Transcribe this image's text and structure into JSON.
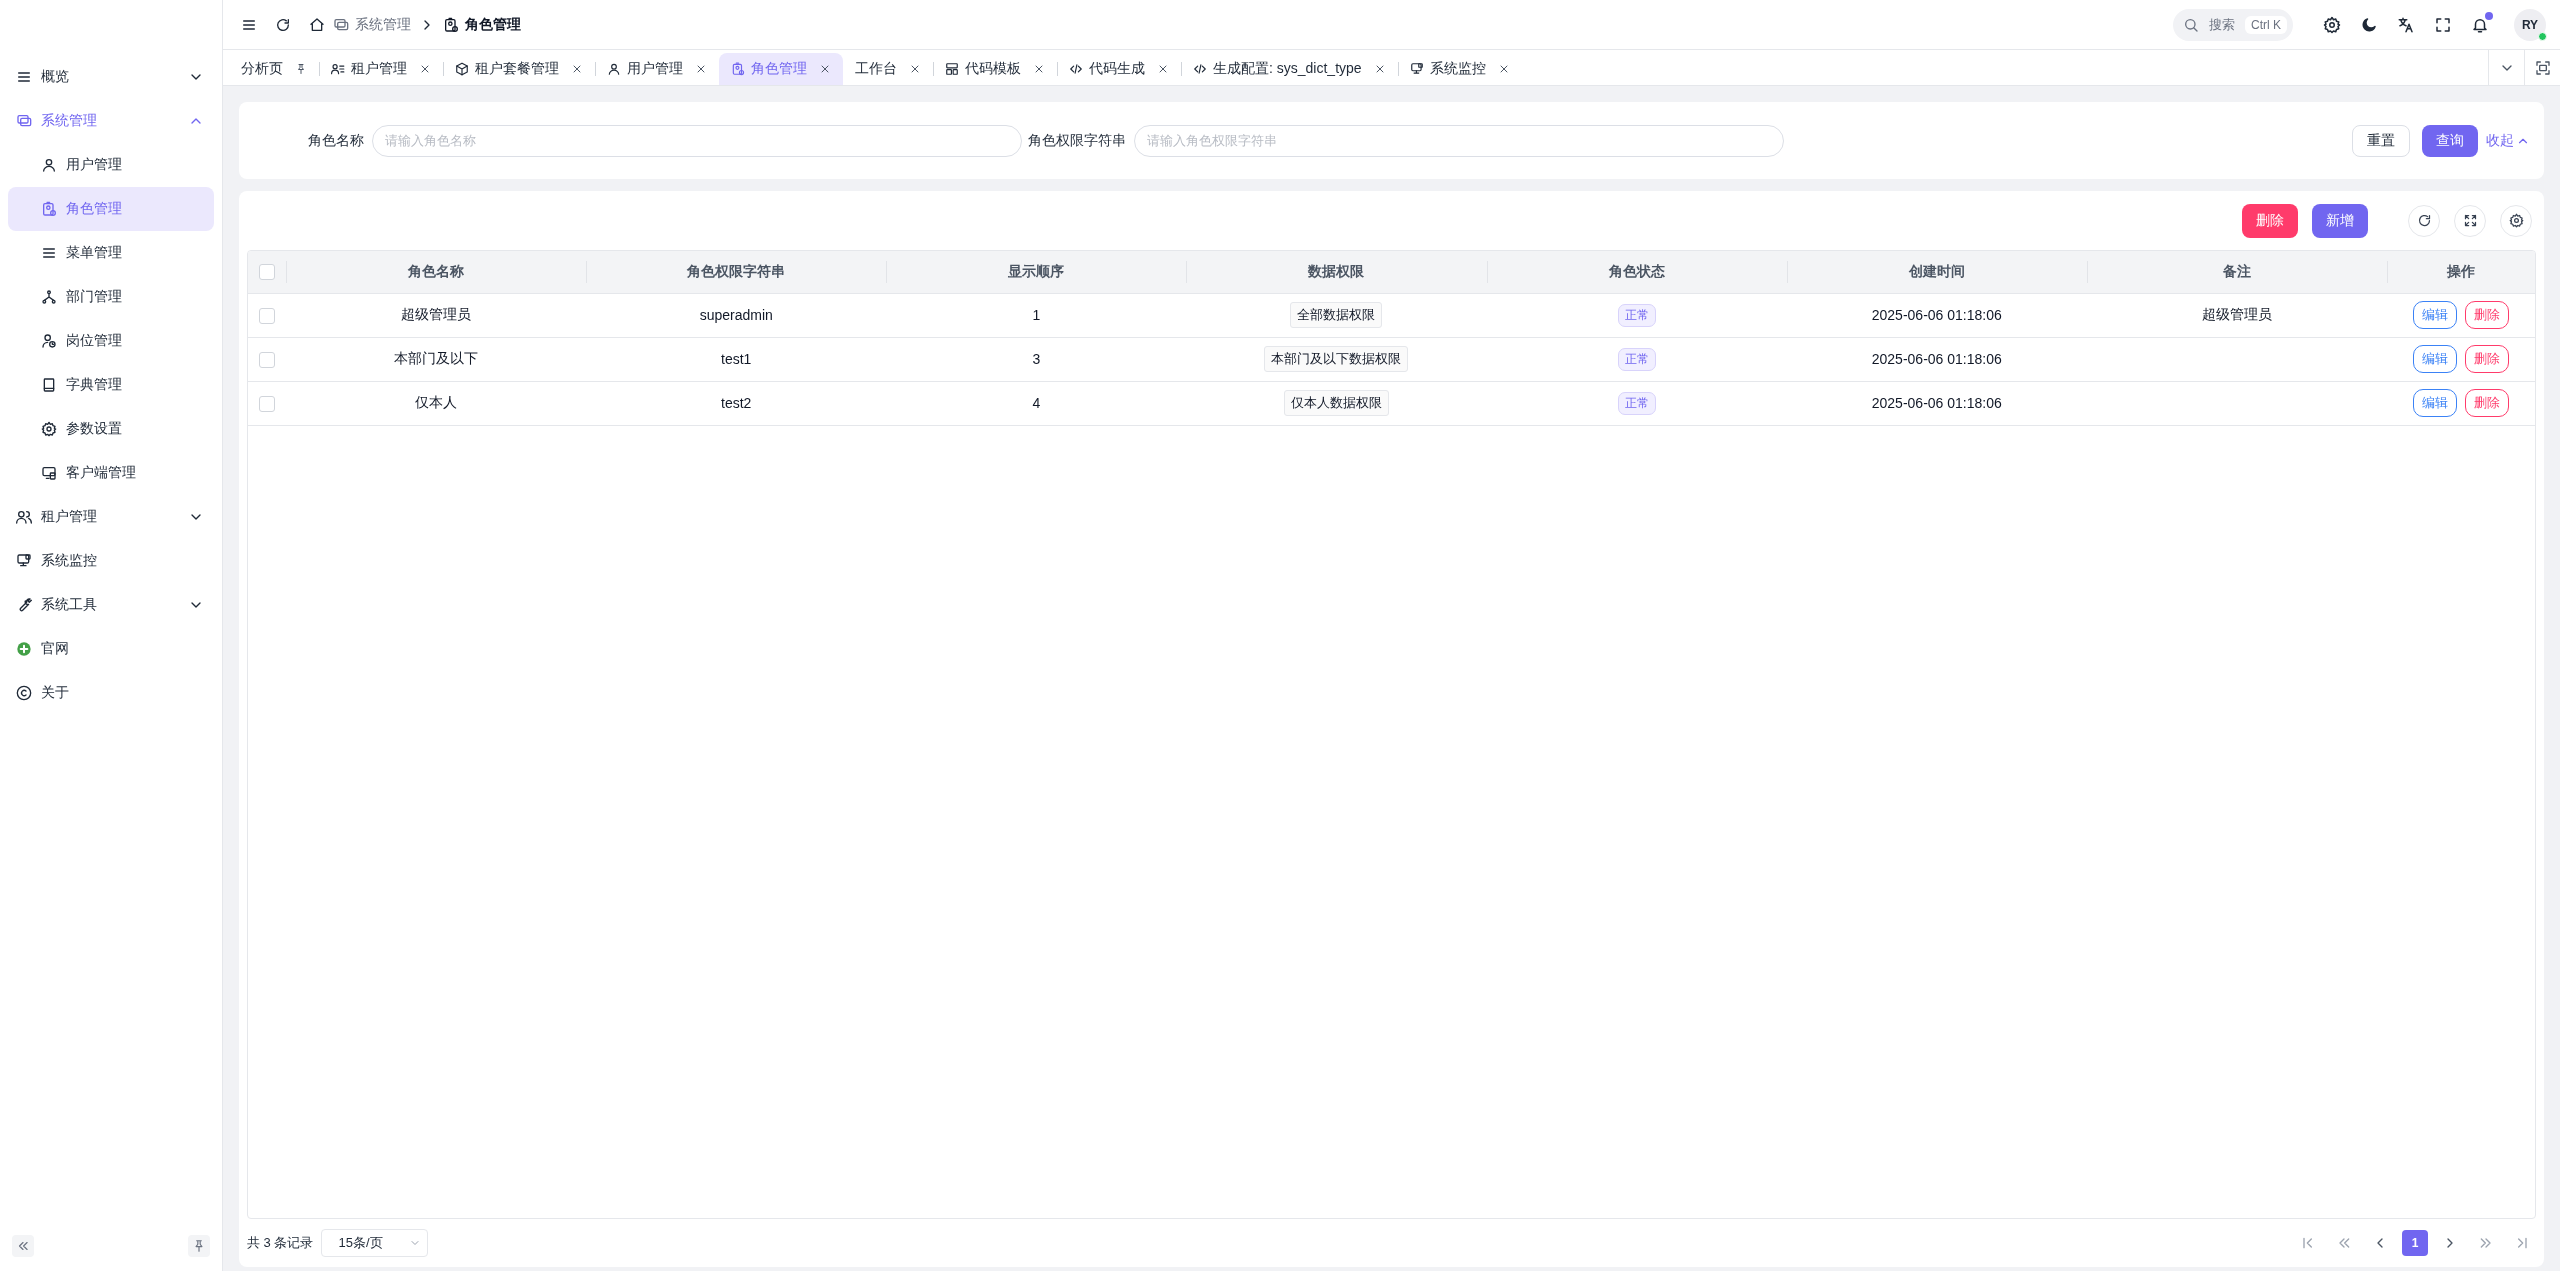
{
  "sidebar": {
    "items": [
      {
        "kind": "group",
        "label": "概览",
        "selected": false,
        "expanded": false
      },
      {
        "kind": "group",
        "label": "系统管理",
        "selected": true,
        "expanded": true,
        "children": [
          {
            "label": "用户管理",
            "selected": false
          },
          {
            "label": "角色管理",
            "selected": true
          },
          {
            "label": "菜单管理",
            "selected": false
          },
          {
            "label": "部门管理",
            "selected": false
          },
          {
            "label": "岗位管理",
            "selected": false
          },
          {
            "label": "字典管理",
            "selected": false
          },
          {
            "label": "参数设置",
            "selected": false
          },
          {
            "label": "客户端管理",
            "selected": false
          }
        ]
      },
      {
        "kind": "group",
        "label": "租户管理",
        "selected": false,
        "expanded": false
      },
      {
        "kind": "link",
        "label": "系统监控",
        "selected": false
      },
      {
        "kind": "group",
        "label": "系统工具",
        "selected": false,
        "expanded": false
      },
      {
        "kind": "link",
        "label": "官网",
        "selected": false
      },
      {
        "kind": "link",
        "label": "关于",
        "selected": false
      }
    ]
  },
  "header": {
    "breadcrumb": [
      {
        "label": "系统管理"
      },
      {
        "label": "角色管理"
      }
    ],
    "search": {
      "placeholder": "搜索",
      "shortcut": "Ctrl K"
    },
    "notifications": {
      "unread": true
    },
    "user": {
      "initials": "RY",
      "online": true
    }
  },
  "tabs": [
    {
      "label": "分析页",
      "selected": false,
      "pinned": true
    },
    {
      "label": "租户管理",
      "selected": false,
      "pinned": false
    },
    {
      "label": "租户套餐管理",
      "selected": false,
      "pinned": false
    },
    {
      "label": "用户管理",
      "selected": false,
      "pinned": false
    },
    {
      "label": "角色管理",
      "selected": true,
      "pinned": false
    },
    {
      "label": "工作台",
      "selected": false,
      "pinned": false
    },
    {
      "label": "代码模板",
      "selected": false,
      "pinned": false
    },
    {
      "label": "代码生成",
      "selected": false,
      "pinned": false
    },
    {
      "label": "生成配置: sys_dict_type",
      "selected": false,
      "pinned": false
    },
    {
      "label": "系统监控",
      "selected": false,
      "pinned": false
    }
  ],
  "search_form": {
    "fields": [
      {
        "label": "角色名称",
        "placeholder": "请输入角色名称"
      },
      {
        "label": "角色权限字符串",
        "placeholder": "请输入角色权限字符串"
      }
    ],
    "buttons": [
      {
        "kind": "default",
        "label": "重置"
      },
      {
        "kind": "primary",
        "label": "查询"
      }
    ],
    "toggle": {
      "label": "收起",
      "expanded": true
    }
  },
  "toolbar": {
    "buttons": [
      {
        "kind": "danger",
        "label": "删除"
      },
      {
        "kind": "primary",
        "label": "新增"
      }
    ]
  },
  "table": {
    "columns": [
      "角色名称",
      "角色权限字符串",
      "显示顺序",
      "数据权限",
      "角色状态",
      "创建时间",
      "备注",
      "操作"
    ],
    "all_checked": false,
    "rows": [
      {
        "checked": false,
        "name": "超级管理员",
        "key": "superadmin",
        "order": "1",
        "data_scope": "全部数据权限",
        "status": "正常",
        "created": "2025-06-06 01:18:06",
        "remark": "超级管理员",
        "actions": [
          "编辑",
          "删除"
        ]
      },
      {
        "checked": false,
        "name": "本部门及以下",
        "key": "test1",
        "order": "3",
        "data_scope": "本部门及以下数据权限",
        "status": "正常",
        "created": "2025-06-06 01:18:06",
        "actions": [
          "编辑",
          "删除"
        ]
      },
      {
        "checked": false,
        "name": "仅本人",
        "key": "test2",
        "order": "4",
        "data_scope": "仅本人数据权限",
        "status": "正常",
        "created": "2025-06-06 01:18:06",
        "actions": [
          "编辑",
          "删除"
        ]
      }
    ]
  },
  "pagination": {
    "total": "共 3 条记录",
    "page_size": "15条/页",
    "pages": [
      {
        "label": "1",
        "selected": true
      }
    ]
  }
}
